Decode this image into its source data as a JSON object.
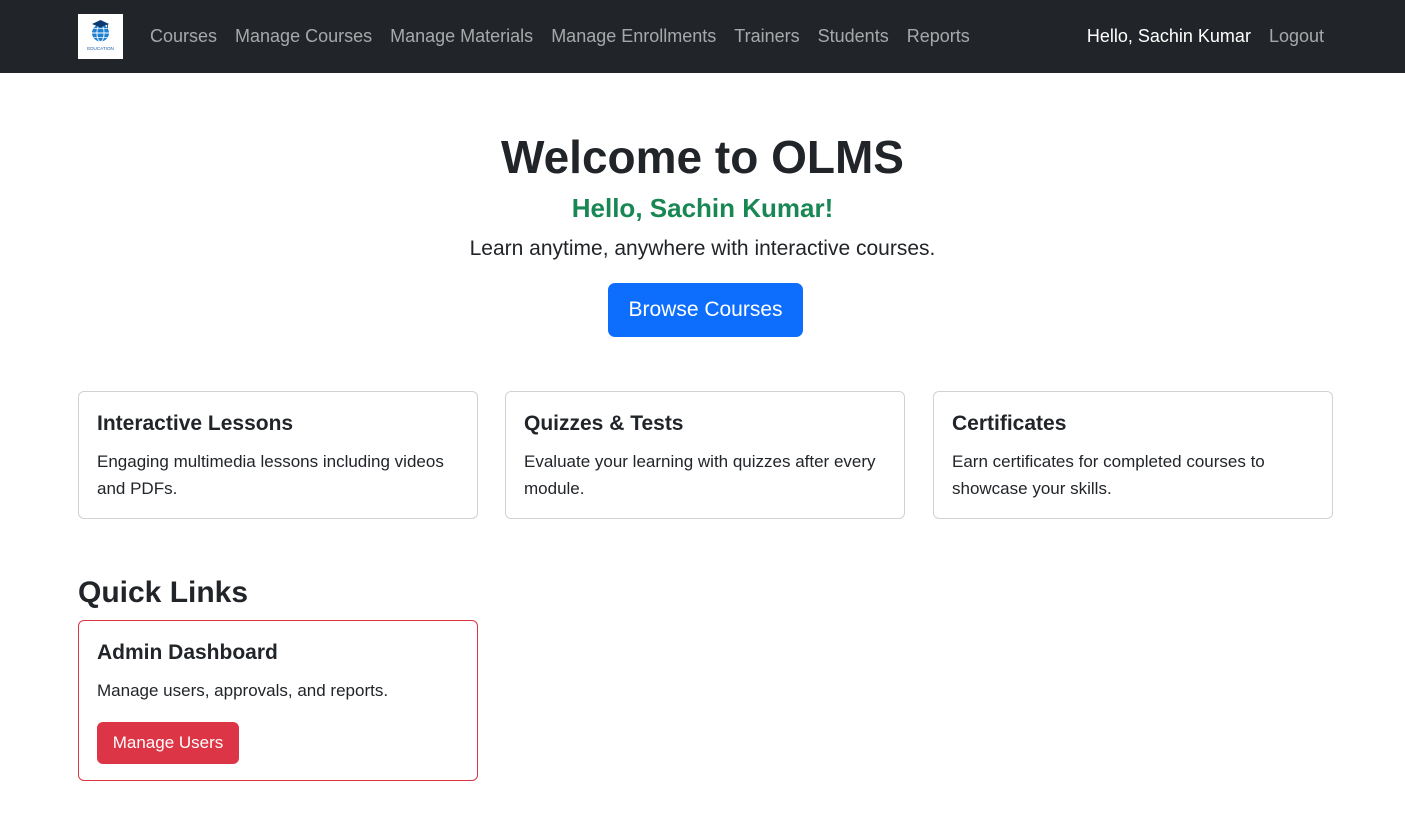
{
  "navbar": {
    "logo_text": "EDUCATION",
    "links": [
      {
        "label": "Courses"
      },
      {
        "label": "Manage Courses"
      },
      {
        "label": "Manage Materials"
      },
      {
        "label": "Manage Enrollments"
      },
      {
        "label": "Trainers"
      },
      {
        "label": "Students"
      },
      {
        "label": "Reports"
      }
    ],
    "greeting": "Hello, Sachin Kumar",
    "logout_label": "Logout",
    "background_color": "#212529"
  },
  "hero": {
    "title": "Welcome to OLMS",
    "hello": "Hello, Sachin Kumar!",
    "lead": "Learn anytime, anywhere with interactive courses.",
    "browse_button": "Browse Courses"
  },
  "features": [
    {
      "title": "Interactive Lessons",
      "text": "Engaging multimedia lessons including videos and PDFs."
    },
    {
      "title": "Quizzes & Tests",
      "text": "Evaluate your learning with quizzes after every module."
    },
    {
      "title": "Certificates",
      "text": "Earn certificates for completed courses to showcase your skills."
    }
  ],
  "quick_links": {
    "heading": "Quick Links",
    "admin_card": {
      "title": "Admin Dashboard",
      "text": "Manage users, approvals, and reports.",
      "button": "Manage Users"
    }
  },
  "colors": {
    "primary": "#0d6efd",
    "success": "#198754",
    "danger": "#dc3545"
  }
}
